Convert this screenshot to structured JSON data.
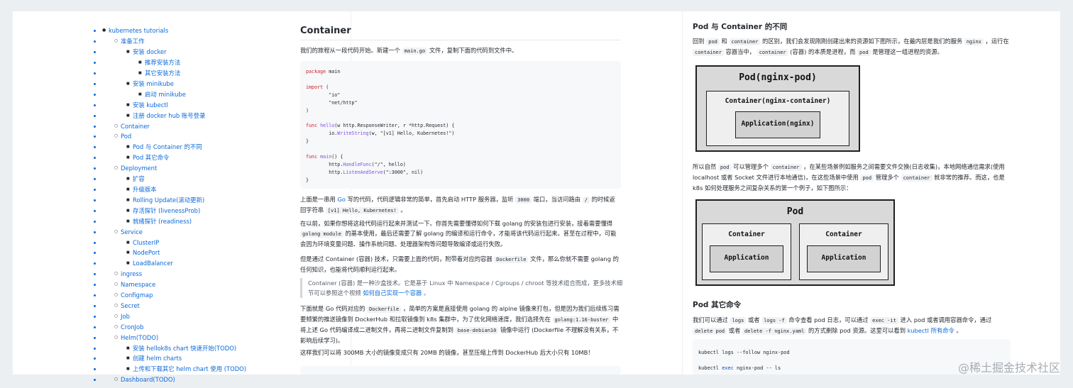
{
  "toc": [
    {
      "level": 1,
      "label": "kubernetes tutorials"
    },
    {
      "level": 2,
      "label": "准备工作"
    },
    {
      "level": 3,
      "label": "安装 docker"
    },
    {
      "level": 4,
      "label": "推荐安装方法"
    },
    {
      "level": 4,
      "label": "其它安装方法"
    },
    {
      "level": 3,
      "label": "安装 minikube"
    },
    {
      "level": 4,
      "label": "启动 minikube"
    },
    {
      "level": 3,
      "label": "安装 kubectl"
    },
    {
      "level": 3,
      "label": "注册 docker hub 账号登录"
    },
    {
      "level": 2,
      "label": "Container"
    },
    {
      "level": 2,
      "label": "Pod"
    },
    {
      "level": 3,
      "label": "Pod 与 Container 的不同"
    },
    {
      "level": 3,
      "label": "Pod 其它命令"
    },
    {
      "level": 2,
      "label": "Deployment"
    },
    {
      "level": 3,
      "label": "扩容"
    },
    {
      "level": 3,
      "label": "升级版本"
    },
    {
      "level": 3,
      "label": "Rolling Update(滚动更新)"
    },
    {
      "level": 3,
      "label": "存活探针 (livenessProb)"
    },
    {
      "level": 3,
      "label": "就绪探针 (readiness)"
    },
    {
      "level": 2,
      "label": "Service"
    },
    {
      "level": 3,
      "label": "ClusterIP"
    },
    {
      "level": 3,
      "label": "NodePort"
    },
    {
      "level": 3,
      "label": "LoadBalancer"
    },
    {
      "level": 2,
      "label": "ingress"
    },
    {
      "level": 2,
      "label": "Namespace"
    },
    {
      "level": 2,
      "label": "Configmap"
    },
    {
      "level": 2,
      "label": "Secret"
    },
    {
      "level": 2,
      "label": "Job"
    },
    {
      "level": 2,
      "label": "CronJob"
    },
    {
      "level": 2,
      "label": "Helm(TODO)"
    },
    {
      "level": 3,
      "label": "安装 hellok8s chart 快速开始(TODO)"
    },
    {
      "level": 3,
      "label": "创建 helm charts"
    },
    {
      "level": 3,
      "label": "上传和下载其它 helm chart 使用 (TODO)"
    },
    {
      "level": 2,
      "label": "Dashboard(TODO)"
    }
  ],
  "container": {
    "title": "Container",
    "intro": {
      "a": "我们的旅程从一段代码开始。新建一个",
      "code": "main.go",
      "b": "文件，复制下面的代码到文件中。"
    },
    "code_lines": [
      {
        "kw": "package",
        "rest": " main"
      },
      {
        "kw": "",
        "rest": ""
      },
      {
        "kw": "import",
        "rest": " ("
      },
      {
        "kw": "",
        "rest": "        \"io\""
      },
      {
        "kw": "",
        "rest": "        \"net/http\""
      },
      {
        "kw": "",
        "rest": ")"
      },
      {
        "kw": "",
        "rest": ""
      },
      {
        "kw": "func",
        "fn": " hello",
        "rest": "(w http.ResponseWriter, r *http.Request) {"
      },
      {
        "kw": "",
        "rest": "        io.",
        "fn2": "WriteString",
        "rest2": "(w, \"[v1] Hello, Kubernetes!\")"
      },
      {
        "kw": "",
        "rest": "}"
      },
      {
        "kw": "",
        "rest": ""
      },
      {
        "kw": "func",
        "fn": " main",
        "rest": "() {"
      },
      {
        "kw": "",
        "rest": "        http.",
        "fn2": "HandleFunc",
        "rest2": "(\"/\", hello)"
      },
      {
        "kw": "",
        "rest": "        http.",
        "fn2": "ListenAndServe",
        "rest2": "(\":3000\", nil)"
      },
      {
        "kw": "",
        "rest": "}"
      }
    ],
    "p1": {
      "a": "上面是一串用",
      "link": "Go",
      "b": "写的代码，代码逻辑非常的简单，首先启动 HTTP 服务器，监听",
      "code1": "3000",
      "c": "端口，当访问路由",
      "code2": "/",
      "d": "的时候返回字符串",
      "code3": "[v1] Hello, Kubernetes!",
      "e": "。"
    },
    "p2": {
      "a": "在以前，如果你想将这段代码运行起来并测试一下。你首先需要懂得如何下载 golang 的安装包进行安装，接着需要懂得",
      "code": "golang module",
      "b": "的基本使用，最后还需要了解 golang 的编译和运行命令，才能将该代码运行起来。甚至在过程中，可能会因为环境变量问题、操作系统问题、处理器架构等问题导致编译或运行失败。"
    },
    "p3": {
      "a": "但是通过 Container (容器) 技术，只需要上面的代码，附带着对应的容器",
      "code": "Dockerfile",
      "b": "文件，那么你就不需要 golang 的任何知识，也能将代码顺利运行起来。"
    },
    "quote": {
      "a": "Container (容器) 是一种沙盒技术。它是基于 Linux 中 Namespace / Cgroups / chroot 等技术组合而成，更多技术细节可以参照这个视频",
      "link": "如何自己实现一个容器",
      "b": "。"
    },
    "p4": {
      "a": "下面就是 Go 代码对应的",
      "code1": "Dockerfile",
      "b": "，简单的方案是直接使用 golang 的 alpine 镜像来打包，但是因为我们后续练习需要频繁的推送镜像到 DockerHub 和拉取镜像到 k8s 集群中，为了优化网络速度，我们选择先在",
      "code2": "golang:1.16-buster",
      "c": "中将上述 Go 代码编译成二进制文件，再将二进制文件复制到",
      "code3": "base-debian10",
      "d": "镜像中运行 (Dockerfile 不理解没有关系，不影响后续学习)。"
    },
    "p5": "这样我们可以将 300MB 大小的镜像变成只有 20MB 的镜像，甚至压缩上传到 DockerHub 后大小只有 10MB！"
  },
  "pod": {
    "h1": "Pod 与 Container 的不同",
    "p1": {
      "a": "回到",
      "c1": "pod",
      "b": "和",
      "c2": "container",
      "c": "的区别，我们会发现刚刚创建出来的资源如下图所示，在最内层是我们的服务",
      "c3": "nginx",
      "d": "，运行在",
      "c4": "container",
      "e": "容器当中，",
      "c5": "container",
      "f": "(容器) 的本质是进程，而",
      "c6": "pod",
      "g": "是管理这一组进程的资源。"
    },
    "diagram1": {
      "pod": "Pod(nginx-pod)",
      "container": "Container(nginx-container)",
      "app": "Application(nginx)"
    },
    "p2": {
      "a": "所以自然",
      "c1": "pod",
      "b": "可以管理多个",
      "c2": "container",
      "c": "，在某些场景例如服务之间需要文件交换(日志收集)，本地网络通信需求(使用 localhost 或者 Socket 文件进行本地通信)，在这些场景中使用",
      "c3": "pod",
      "d": "管理多个",
      "c4": "container",
      "e": "就非常的推荐。而这，也是 k8s 如何处理服务之间复杂关系的第一个例子，如下图所示："
    },
    "diagram2": {
      "pod": "Pod",
      "container1": "Container",
      "app1": "Application",
      "container2": "Container",
      "app2": "Application"
    },
    "h2": "Pod 其它命令",
    "p3": {
      "a": "我们可以通过",
      "c1": "logs",
      "b": "或者",
      "c2": "logs -f",
      "c": "命令查看 pod 日志，可以通过",
      "c3": "exec -it",
      "d": "进入 pod 或者调用容器命令，通过",
      "c4": "delete pod",
      "e": "或者",
      "c5": "delete -f nginx.yaml",
      "f": "的方式删除 pod 资源。这里可以看到",
      "link": "kubectl 所有命令",
      "g": "。"
    },
    "cmd1": "kubectl logs --follow nginx-pod",
    "cmd2a": "kubectl ",
    "cmd2kw": "exec",
    "cmd2b": " nginx-pod -- ls"
  },
  "watermark": "@稀土掘金技术社区"
}
